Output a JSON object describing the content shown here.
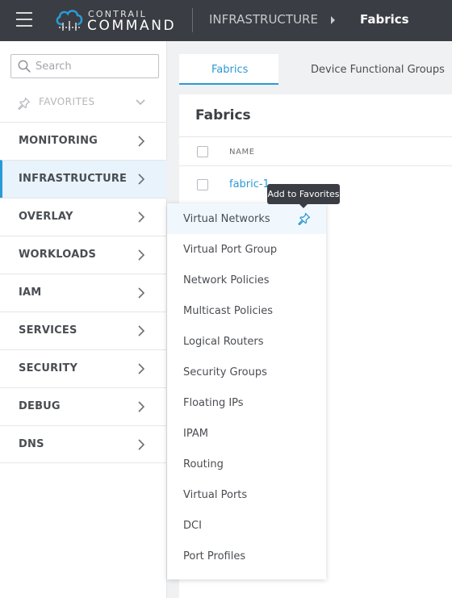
{
  "header": {
    "brand_top": "CONTRAIL",
    "brand_bottom": "COMMAND",
    "breadcrumb": [
      "INFRASTRUCTURE",
      "Fabrics"
    ],
    "colors": {
      "bar": "#3a3d43",
      "logo_accent": "#2a9ad6"
    }
  },
  "sidebar": {
    "search_placeholder": "Search",
    "favorites_label": "FAVORITES",
    "items": [
      {
        "label": "MONITORING",
        "active": false
      },
      {
        "label": "INFRASTRUCTURE",
        "active": true
      },
      {
        "label": "OVERLAY",
        "active": false
      },
      {
        "label": "WORKLOADS",
        "active": false
      },
      {
        "label": "IAM",
        "active": false
      },
      {
        "label": "SERVICES",
        "active": false
      },
      {
        "label": "SECURITY",
        "active": false
      },
      {
        "label": "DEBUG",
        "active": false
      },
      {
        "label": "DNS",
        "active": false
      }
    ]
  },
  "tabs": [
    {
      "label": "Fabrics",
      "active": true
    },
    {
      "label": "Device Functional Groups",
      "active": false
    }
  ],
  "card": {
    "title": "Fabrics",
    "column_header": "NAME",
    "rows": [
      {
        "name": "fabric-1"
      }
    ]
  },
  "menu": {
    "items": [
      "Virtual Networks",
      "Virtual Port Group",
      "Network Policies",
      "Multicast Policies",
      "Logical Routers",
      "Security Groups",
      "Floating IPs",
      "IPAM",
      "Routing",
      "Virtual Ports",
      "DCI",
      "Port Profiles"
    ],
    "hovered_item": "Virtual Networks"
  },
  "tooltip": {
    "text": "Add to Favorites"
  },
  "icons": {
    "menu": "hamburger-icon",
    "search": "search-icon",
    "pin": "pin-icon",
    "chevron": "chevron-right-icon"
  },
  "accent_color": "#2a9ad6"
}
